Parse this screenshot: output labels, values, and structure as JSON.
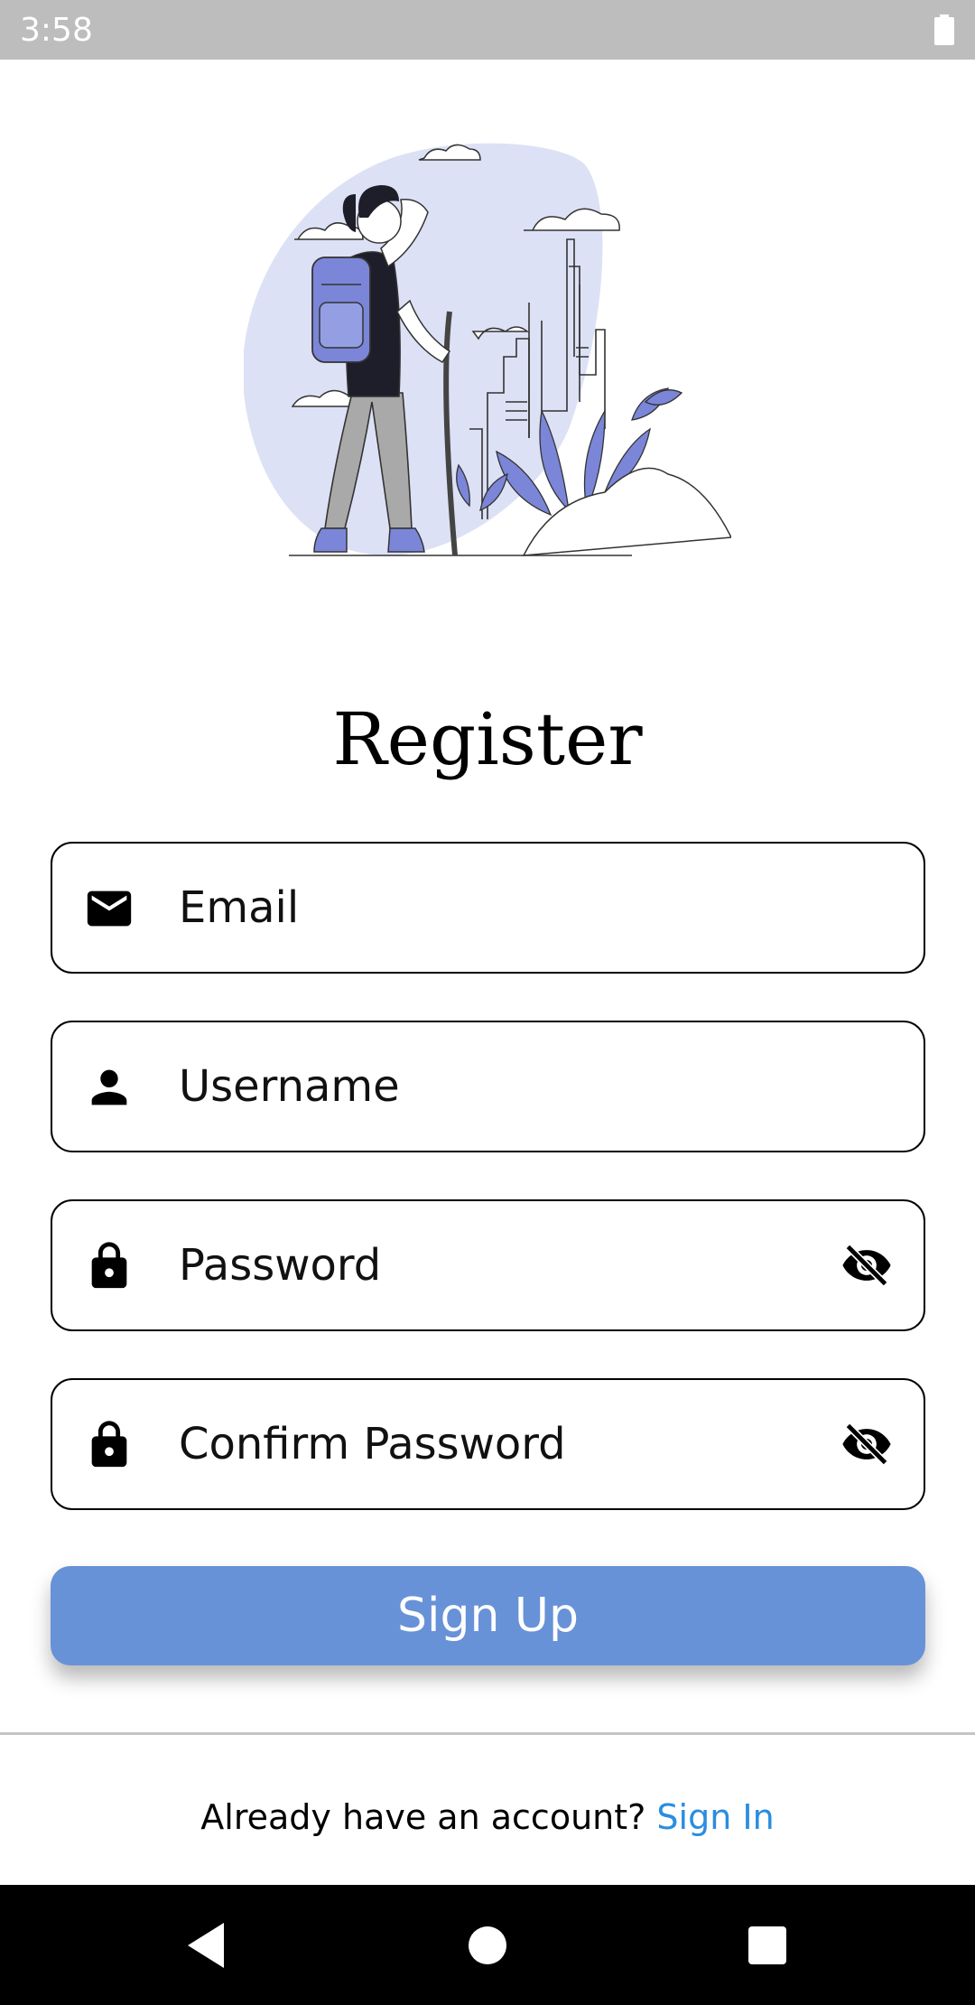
{
  "status_bar": {
    "time": "3:58",
    "battery_icon": "battery-full-icon"
  },
  "illustration": {
    "name": "hiker-city-illustration"
  },
  "title": "Register",
  "fields": {
    "email": {
      "placeholder": "Email",
      "value": "",
      "icon": "mail-icon"
    },
    "username": {
      "placeholder": "Username",
      "value": "",
      "icon": "person-icon"
    },
    "password": {
      "placeholder": "Password",
      "value": "",
      "icon": "lock-icon",
      "toggle_icon": "visibility-off-icon"
    },
    "confirm_password": {
      "placeholder": "Confirm Password",
      "value": "",
      "icon": "lock-icon",
      "toggle_icon": "visibility-off-icon"
    }
  },
  "signup_button": {
    "label": "Sign Up"
  },
  "footer": {
    "prompt": "Already have an account?",
    "link": "Sign In"
  },
  "nav_bar": {
    "back_icon": "back-triangle-icon",
    "home_icon": "home-circle-icon",
    "recents_icon": "recents-square-icon"
  },
  "colors": {
    "accent_button": "#6892d7",
    "link": "#2a8de0",
    "status_bar": "#bdbdbd",
    "illustration_blob": "#dde1f5",
    "illustration_accent": "#7b86d8"
  }
}
